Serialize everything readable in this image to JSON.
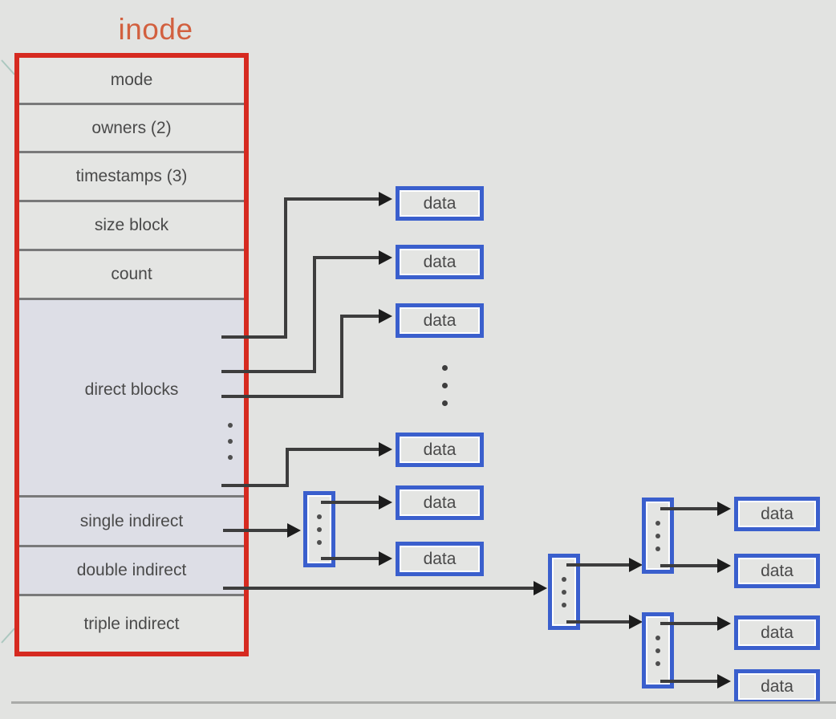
{
  "diagram": {
    "title": "inode",
    "title_color": "#d2603f",
    "inode_border_color": "#d62a20",
    "block_border_color": "#3a5fcd",
    "line_color": "#3d3d3d",
    "background_color": "#e2e3e1"
  },
  "inode_fields": [
    {
      "label": "mode"
    },
    {
      "label": "owners (2)"
    },
    {
      "label": "timestamps (3)"
    },
    {
      "label": "size block"
    },
    {
      "label": "count"
    },
    {
      "label": "direct blocks"
    },
    {
      "label": "single indirect"
    },
    {
      "label": "double indirect"
    },
    {
      "label": "triple indirect"
    }
  ],
  "data_blocks": {
    "label": "data",
    "direct": [
      {
        "label": "data"
      },
      {
        "label": "data"
      },
      {
        "label": "data"
      }
    ],
    "single_indirect_targets": [
      {
        "label": "data"
      },
      {
        "label": "data"
      },
      {
        "label": "data"
      }
    ],
    "triple_indirect_targets": [
      {
        "label": "data"
      },
      {
        "label": "data"
      },
      {
        "label": "data"
      },
      {
        "label": "data"
      }
    ]
  },
  "indirect_blocks": [
    {
      "name": "single-indirect-block"
    },
    {
      "name": "double-indirect-level1-block"
    },
    {
      "name": "triple-indirect-level2-upper-block"
    },
    {
      "name": "triple-indirect-level2-lower-block"
    }
  ],
  "ellipsis": {
    "direct_blocks": "vertical-ellipsis",
    "data_column": "vertical-ellipsis"
  }
}
